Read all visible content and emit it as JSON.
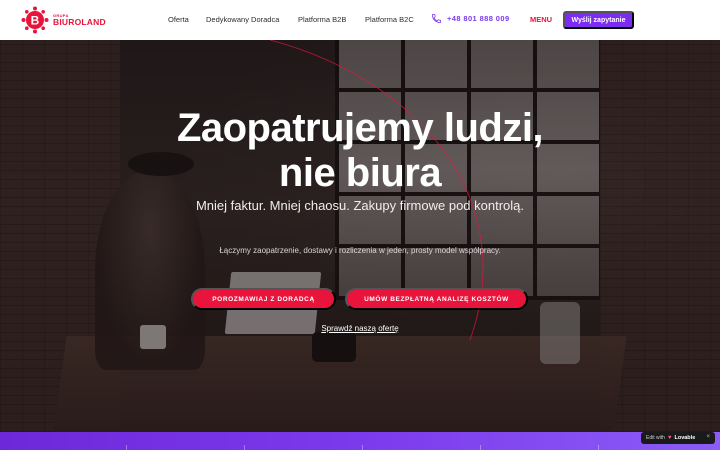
{
  "brand": {
    "small": "GRUPA",
    "name": "BIUROLAND",
    "color": "#e8143c"
  },
  "nav": {
    "items": [
      {
        "label": "Oferta"
      },
      {
        "label": "Dedykowany Doradca"
      },
      {
        "label": "Platforma B2B"
      },
      {
        "label": "Platforma B2C"
      }
    ],
    "phone": "+48 801 888 009",
    "phone_icon": "phone-icon",
    "menu": "MENU",
    "cta": "Wyślij zapytanie",
    "accent": "#7c2cf0"
  },
  "hero": {
    "title_line1": "Zaopatrujemy ludzi,",
    "title_line2": "nie biura",
    "subtitle": "Mniej faktur. Mniej chaosu. Zakupy firmowe pod kontrolą.",
    "description": "Łączymy zaopatrzenie, dostawy i rozliczenia w jeden, prosty model współpracy.",
    "button_consult": "POROZMAWIAJ Z DORADCĄ",
    "button_analysis": "UMÓW BEZPŁATNĄ ANALIZĘ KOSZTÓW",
    "offer_link": "Sprawdź naszą ofertę",
    "button_color": "#e8143c"
  },
  "badge": {
    "edit": "Edit with",
    "brand": "Lovable",
    "close": "×"
  }
}
